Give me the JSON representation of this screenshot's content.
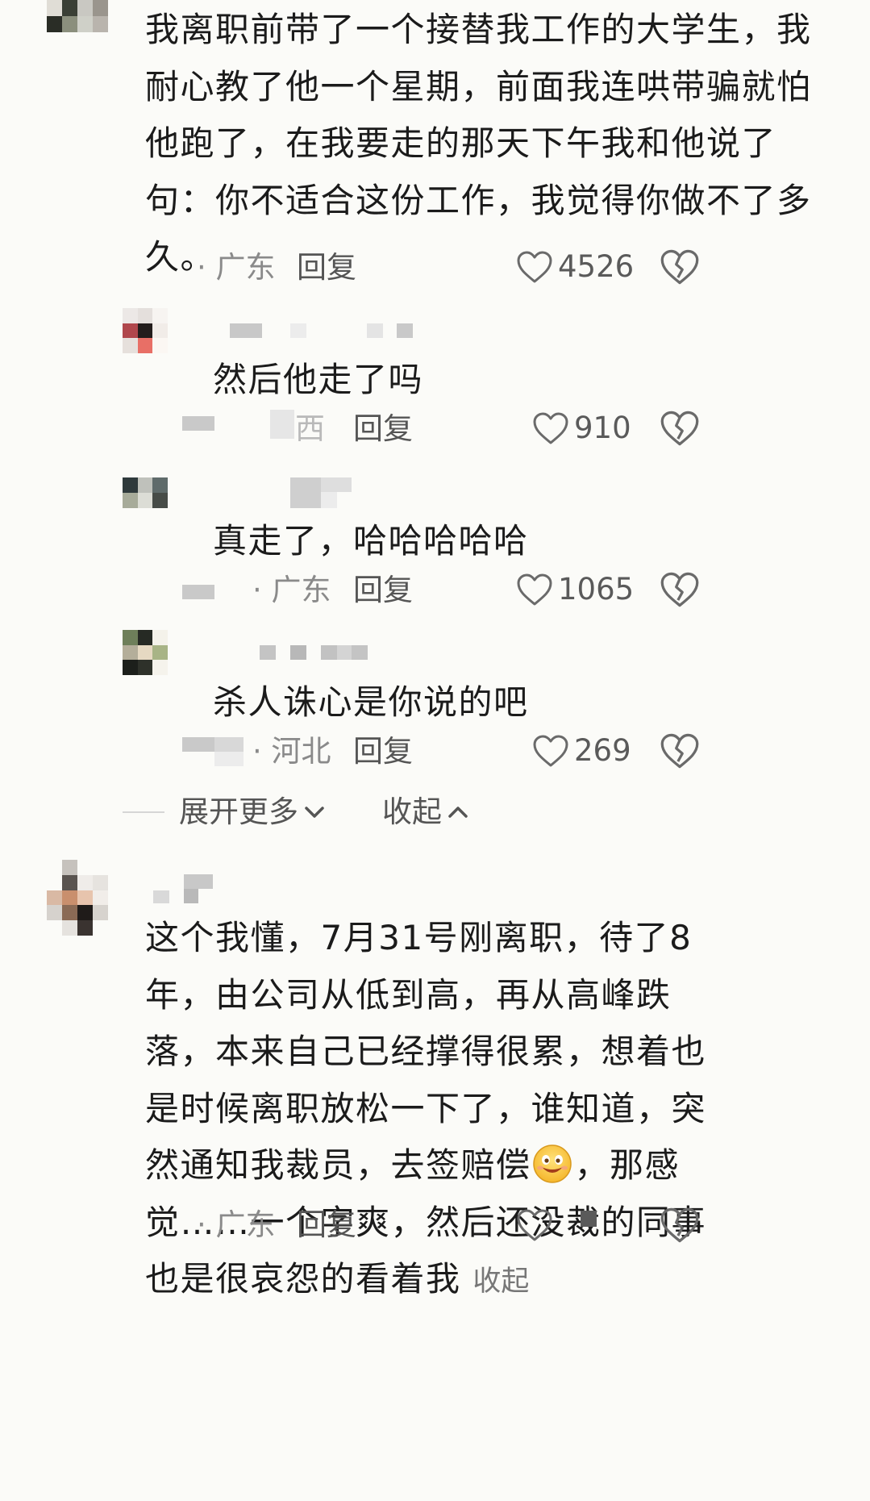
{
  "comments": [
    {
      "text": "我离职前带了一个接替我工作的大学生，我耐心教了他一个星期，前面我连哄带骗就怕他跑了，在我要走的那天下午我和他说了句：你不适合这份工作，我觉得你做不了多久。",
      "location": "· 广东",
      "reply_label": "回复",
      "likes": "4526",
      "replies": [
        {
          "text": "然后他走了吗",
          "location": "西",
          "reply_label": "回复",
          "likes": "910"
        },
        {
          "text": "真走了，哈哈哈哈哈",
          "location": "· 广东",
          "reply_label": "回复",
          "likes": "1065"
        },
        {
          "text": "杀人诛心是你说的吧",
          "location": "· 河北",
          "reply_label": "回复",
          "likes": "269"
        }
      ],
      "expand_more_label": "展开更多",
      "collapse_label": "收起"
    },
    {
      "text": "这个我懂，7月31号刚离职，待了8年，由公司从低到高，再从高峰跌落，本来自己已经撑得很累，想着也是时候离职放松一下了，谁知道，突然通知我裁员，去签赔偿",
      "text_after_emoji": "，那感觉……一个字爽，然后还没裁的同事也是很哀怨的看着我",
      "inline_collapse_label": "收起",
      "emoji": "grinning-face-emoji",
      "location": "· 广东",
      "reply_label": "回复"
    }
  ],
  "colors": {
    "text": "#1b1b1b",
    "meta": "#8a8a8a",
    "icon": "#6a6a6a",
    "background": "#fbfbf8"
  }
}
